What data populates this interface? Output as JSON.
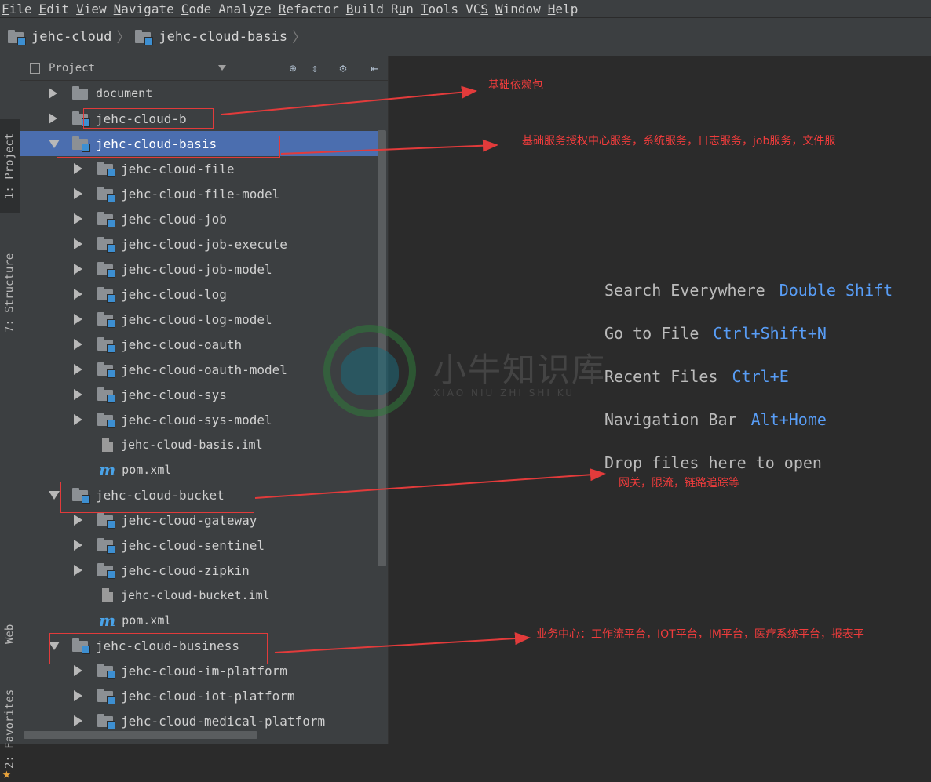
{
  "menu": [
    {
      "label": "File",
      "u": "F"
    },
    {
      "label": "Edit",
      "u": "E"
    },
    {
      "label": "View",
      "u": "V"
    },
    {
      "label": "Navigate",
      "u": "N"
    },
    {
      "label": "Code",
      "u": "C"
    },
    {
      "label": "Analyze",
      "u": "z"
    },
    {
      "label": "Refactor",
      "u": "R"
    },
    {
      "label": "Build",
      "u": "B"
    },
    {
      "label": "Run",
      "u": "u"
    },
    {
      "label": "Tools",
      "u": "T"
    },
    {
      "label": "VCS",
      "u": "S"
    },
    {
      "label": "Window",
      "u": "W"
    },
    {
      "label": "Help",
      "u": "H"
    }
  ],
  "breadcrumb": [
    "jehc-cloud",
    "jehc-cloud-basis"
  ],
  "left_tabs": {
    "project": "1: Project",
    "structure": "7: Structure",
    "web": "Web",
    "favorites": "2: Favorites"
  },
  "panel": {
    "title": "Project"
  },
  "tree": [
    {
      "label": "document",
      "type": "folder-plain",
      "arrow": "r",
      "indent": 0
    },
    {
      "label": "jehc-cloud-b",
      "type": "module",
      "arrow": "r",
      "indent": 0
    },
    {
      "label": "jehc-cloud-basis",
      "type": "module",
      "arrow": "d",
      "indent": 0,
      "selected": true
    },
    {
      "label": "jehc-cloud-file",
      "type": "module",
      "arrow": "r",
      "indent": 1
    },
    {
      "label": "jehc-cloud-file-model",
      "type": "module",
      "arrow": "r",
      "indent": 1
    },
    {
      "label": "jehc-cloud-job",
      "type": "module",
      "arrow": "r",
      "indent": 1
    },
    {
      "label": "jehc-cloud-job-execute",
      "type": "module",
      "arrow": "r",
      "indent": 1
    },
    {
      "label": "jehc-cloud-job-model",
      "type": "module",
      "arrow": "r",
      "indent": 1
    },
    {
      "label": "jehc-cloud-log",
      "type": "module",
      "arrow": "r",
      "indent": 1
    },
    {
      "label": "jehc-cloud-log-model",
      "type": "module",
      "arrow": "r",
      "indent": 1
    },
    {
      "label": "jehc-cloud-oauth",
      "type": "module",
      "arrow": "r",
      "indent": 1
    },
    {
      "label": "jehc-cloud-oauth-model",
      "type": "module",
      "arrow": "r",
      "indent": 1
    },
    {
      "label": "jehc-cloud-sys",
      "type": "module",
      "arrow": "r",
      "indent": 1
    },
    {
      "label": "jehc-cloud-sys-model",
      "type": "module",
      "arrow": "r",
      "indent": 1
    },
    {
      "label": "jehc-cloud-basis.iml",
      "type": "iml",
      "arrow": "",
      "indent": 1
    },
    {
      "label": "pom.xml",
      "type": "pom",
      "arrow": "",
      "indent": 1
    },
    {
      "label": "jehc-cloud-bucket",
      "type": "module",
      "arrow": "d",
      "indent": 0
    },
    {
      "label": "jehc-cloud-gateway",
      "type": "module",
      "arrow": "r",
      "indent": 1
    },
    {
      "label": "jehc-cloud-sentinel",
      "type": "module",
      "arrow": "r",
      "indent": 1
    },
    {
      "label": "jehc-cloud-zipkin",
      "type": "module",
      "arrow": "r",
      "indent": 1
    },
    {
      "label": "jehc-cloud-bucket.iml",
      "type": "iml",
      "arrow": "",
      "indent": 1
    },
    {
      "label": "pom.xml",
      "type": "pom",
      "arrow": "",
      "indent": 1
    },
    {
      "label": "jehc-cloud-business",
      "type": "module",
      "arrow": "d",
      "indent": 0
    },
    {
      "label": "jehc-cloud-im-platform",
      "type": "module",
      "arrow": "r",
      "indent": 1
    },
    {
      "label": "jehc-cloud-iot-platform",
      "type": "module",
      "arrow": "r",
      "indent": 1
    },
    {
      "label": "jehc-cloud-medical-platform",
      "type": "module",
      "arrow": "r",
      "indent": 1
    }
  ],
  "hints": [
    {
      "text": "Search Everywhere",
      "key": "Double Shift"
    },
    {
      "text": "Go to File",
      "key": "Ctrl+Shift+N"
    },
    {
      "text": "Recent Files",
      "key": "Ctrl+E"
    },
    {
      "text": "Navigation Bar",
      "key": "Alt+Home"
    },
    {
      "text": "Drop files here to open",
      "key": ""
    }
  ],
  "watermark": {
    "text": "小牛知识库",
    "sub": "XIAO NIU ZHI SHI KU"
  },
  "annotations": [
    {
      "text": "基础依赖包"
    },
    {
      "text": "基础服务授权中心服务，系统服务，日志服务，job服务，文件服"
    },
    {
      "text": "网关，限流，链路追踪等"
    },
    {
      "text": "业务中心：工作流平台，IOT平台，IM平台，医疗系统平台，报表平"
    }
  ],
  "colors": {
    "accent": "#4b6eaf",
    "key": "#589df6",
    "annotation": "#e23b3b",
    "background": "#2b2b2b"
  }
}
